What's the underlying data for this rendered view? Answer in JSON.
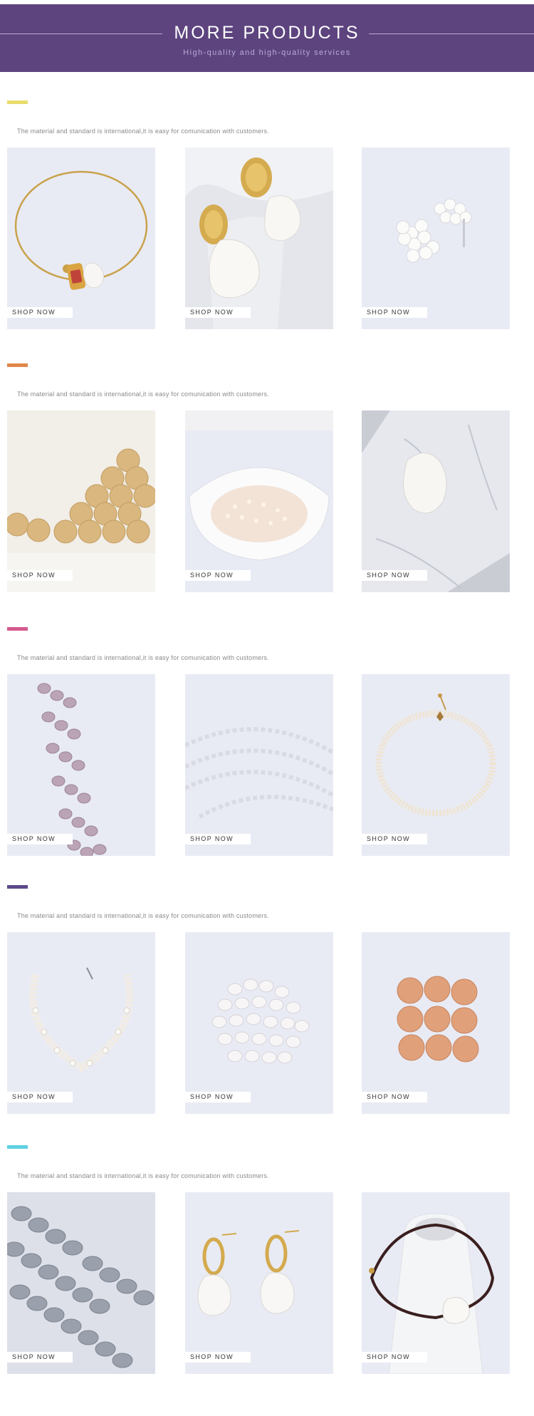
{
  "header": {
    "title": "MORE PRODUCTS",
    "subtitle": "High-quality and high-quality services"
  },
  "colors": {
    "banner": "#5d447f",
    "card_bg": "#e9ebf4"
  },
  "sections": [
    {
      "accent_color": "#e8dc6a",
      "description": "The material and standard is international,it is easy for comunication with customers.",
      "products": [
        {
          "image": "gold-bangle-with-baroque-pearl",
          "button": "SHOP NOW"
        },
        {
          "image": "gold-stud-baroque-pearl-earrings",
          "button": "SHOP NOW"
        },
        {
          "image": "pearl-flower-stud-earrings",
          "button": "SHOP NOW"
        }
      ]
    },
    {
      "accent_color": "#e0874a",
      "description": "The material and standard is international,it is easy for comunication with customers.",
      "products": [
        {
          "image": "golden-round-pearls",
          "button": "SHOP NOW"
        },
        {
          "image": "seed-pearls-in-shell-dish",
          "button": "SHOP NOW"
        },
        {
          "image": "single-baroque-pearl-on-marble",
          "button": "SHOP NOW"
        }
      ]
    },
    {
      "accent_color": "#d45a8f",
      "description": "The material and standard is international,it is easy for comunication with customers.",
      "products": [
        {
          "image": "lavender-coin-pearl-strands",
          "button": "SHOP NOW"
        },
        {
          "image": "white-keshi-pearl-strands",
          "button": "SHOP NOW"
        },
        {
          "image": "seed-pearl-woven-necklace",
          "button": "SHOP NOW"
        }
      ]
    },
    {
      "accent_color": "#5b4a8a",
      "description": "The material and standard is international,it is easy for comunication with customers.",
      "products": [
        {
          "image": "pearl-collar-necklace",
          "button": "SHOP NOW"
        },
        {
          "image": "white-coin-pearls-pile",
          "button": "SHOP NOW"
        },
        {
          "image": "peach-coin-pearls-grid",
          "button": "SHOP NOW"
        }
      ]
    },
    {
      "accent_color": "#5fd0e3",
      "description": "The material and standard is international,it is easy for comunication with customers.",
      "products": [
        {
          "image": "grey-baroque-pearl-strands",
          "button": "SHOP NOW"
        },
        {
          "image": "gold-hoop-baroque-pearl-drop-earrings",
          "button": "SHOP NOW"
        },
        {
          "image": "cord-bracelet-baroque-pearl-on-vase",
          "button": "SHOP NOW"
        }
      ]
    }
  ]
}
